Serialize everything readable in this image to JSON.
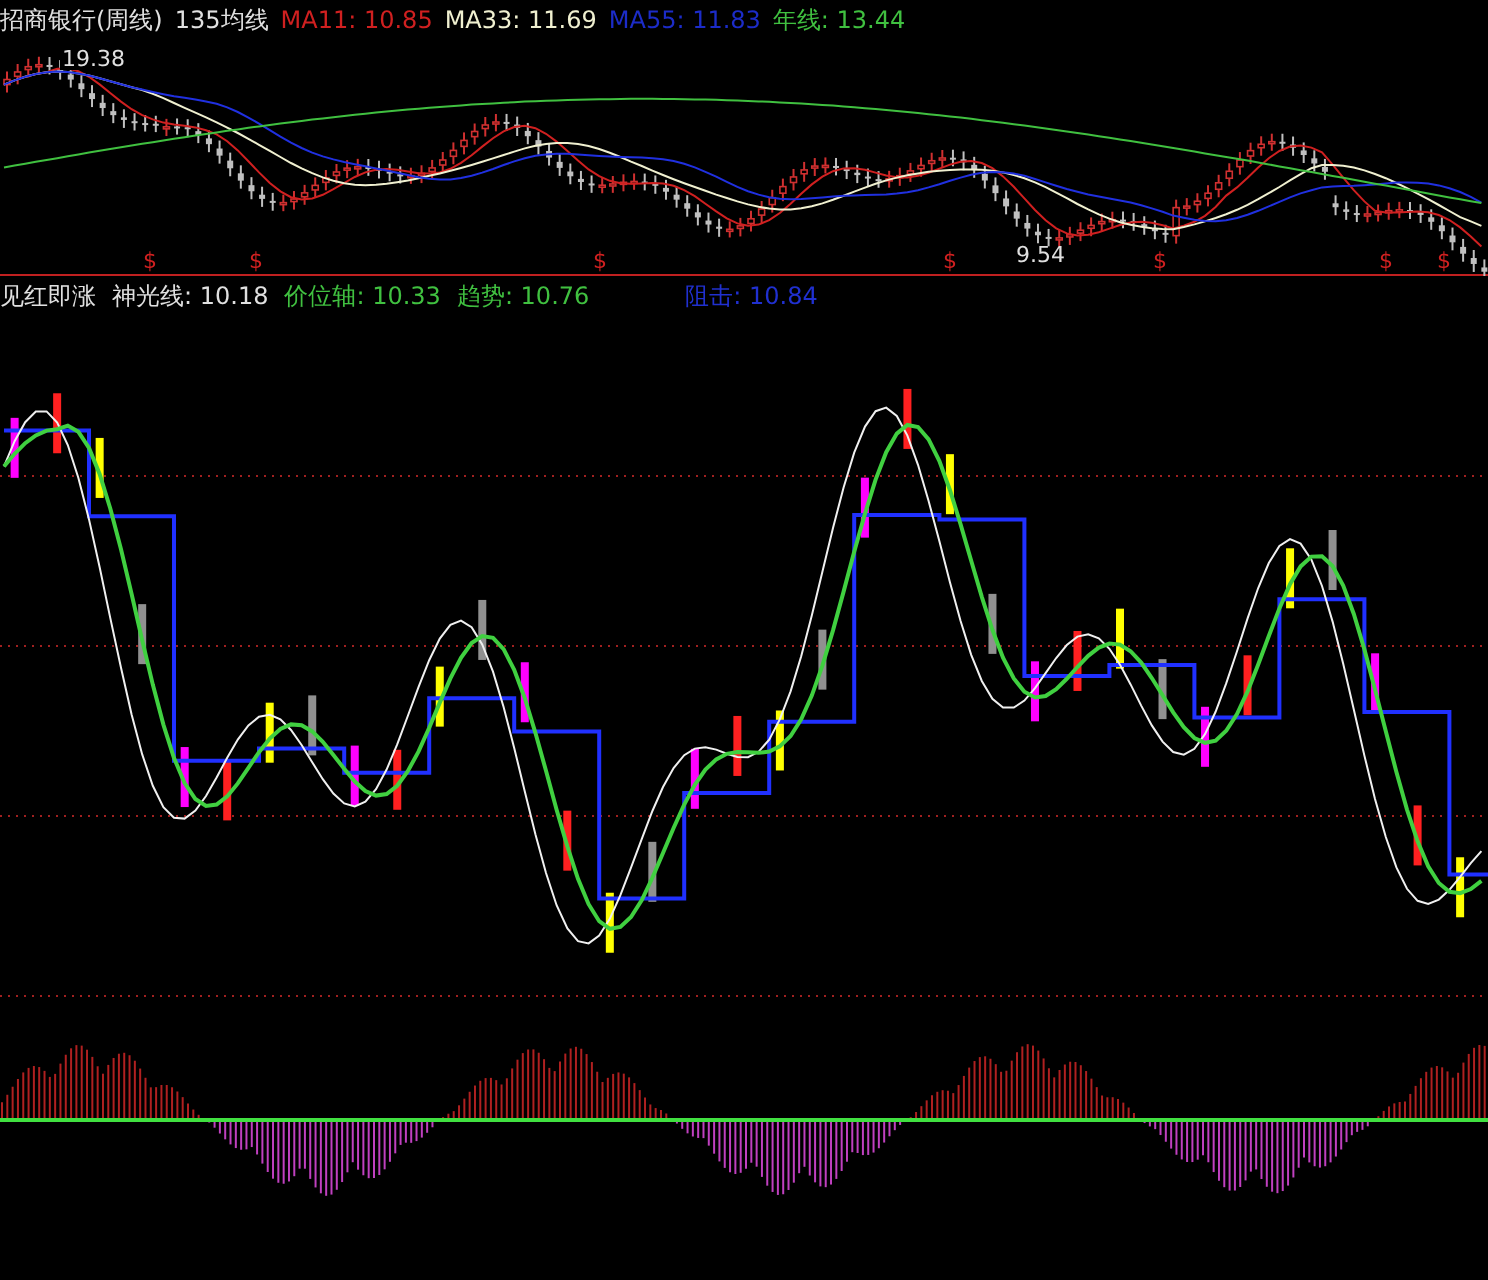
{
  "price_header": [
    {
      "text": "招商银行(周线)",
      "color": "#e0e0e0"
    },
    {
      "text": "135均线",
      "color": "#e0e0e0"
    },
    {
      "text": "MA11: 10.85",
      "color": "#d02020"
    },
    {
      "text": "MA33: 11.69",
      "color": "#f0f0d0"
    },
    {
      "text": "MA55: 11.83",
      "color": "#1c2cc8"
    },
    {
      "text": "年线: 13.44",
      "color": "#40c040"
    }
  ],
  "price_chart": {
    "high_label": "19.38",
    "low_label": "9.54",
    "signals": [
      "$",
      "$",
      "$",
      "$",
      "$",
      "$",
      "$"
    ]
  },
  "indicator_header": [
    {
      "text": "见红即涨",
      "color": "#e0e0e0"
    },
    {
      "text": "神光线: 10.18",
      "color": "#e0e0e0"
    },
    {
      "text": "价位轴: 10.33",
      "color": "#40c040"
    },
    {
      "text": "趋势: 10.76",
      "color": "#40c040"
    },
    {
      "text": "阻击: 10.84",
      "color": "#2030d0"
    }
  ]
}
